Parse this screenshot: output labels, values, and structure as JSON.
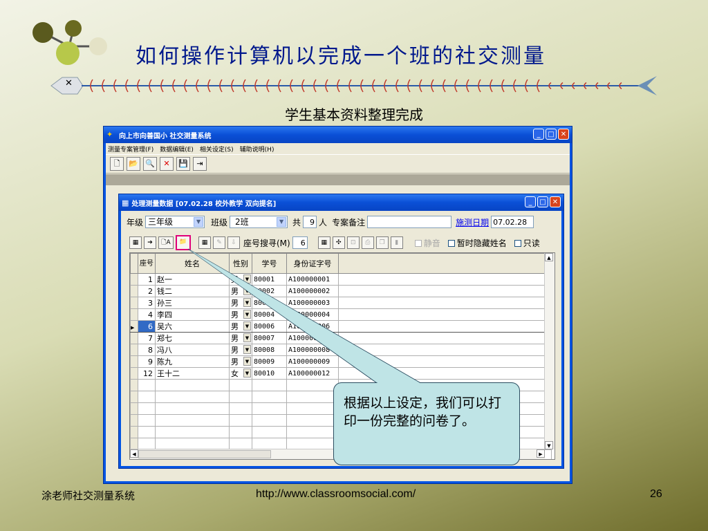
{
  "slide": {
    "title": "如何操作计算机以完成一个班的社交测量",
    "subtitle": "学生基本资料整理完成",
    "footer_left": "涂老师社交测量系统",
    "footer_url": "http://www.classroomsocial.com/",
    "page_number": "26",
    "fishbone_x": "✕"
  },
  "app": {
    "title": "向上市向善国小 社交测量系统",
    "menus": [
      "测量专案管理(F)",
      "数据编辑(E)",
      "相关设定(S)",
      "辅助说明(H)"
    ],
    "toolbar_icons": [
      "new-icon",
      "open-icon",
      "search-icon",
      "close-icon",
      "save-icon",
      "exit-icon"
    ],
    "toolbar_glyphs": [
      "🗋",
      "📂",
      "🔍",
      "✕",
      "💾",
      "⇥"
    ],
    "win_min": "_",
    "win_max": "□",
    "win_close": "✕"
  },
  "child": {
    "title": "处理测量数据 [07.02.28 校外教学 双向提名]",
    "grade_label": "年级",
    "grade_value": "三年级",
    "class_label": "班级",
    "class_value": "2班",
    "total_label": "共",
    "total_value": "9",
    "total_unit": "人",
    "note_label": "专案备注",
    "note_value": "",
    "date_label": "施测日期",
    "date_value": "07.02.28",
    "seat_search_label": "座号搜寻(M)",
    "seat_search_value": "6",
    "btn_grid": "▦",
    "btn_arrow": "➔",
    "btn_doc": "🗋A",
    "btn_folder": "📁",
    "btn_table": "▦",
    "mute_label": "静音",
    "hide_name_label": "暂时隐藏姓名",
    "readonly_label": "只读"
  },
  "grid": {
    "headers": [
      "座号",
      "姓名",
      "性别",
      "学号",
      "身份证字号"
    ],
    "rows": [
      {
        "seat": "1",
        "name": "赵一",
        "sex": "男",
        "sid": "80001",
        "idno": "A100000001"
      },
      {
        "seat": "2",
        "name": "钱二",
        "sex": "男",
        "sid": "80002",
        "idno": "A100000002"
      },
      {
        "seat": "3",
        "name": "孙三",
        "sex": "男",
        "sid": "80003",
        "idno": "A100000003"
      },
      {
        "seat": "4",
        "name": "李四",
        "sex": "男",
        "sid": "80004",
        "idno": "A100000004"
      },
      {
        "seat": "6",
        "name": "吴六",
        "sex": "男",
        "sid": "80006",
        "idno": "A100000006"
      },
      {
        "seat": "7",
        "name": "郑七",
        "sex": "男",
        "sid": "80007",
        "idno": "A100000007"
      },
      {
        "seat": "8",
        "name": "冯八",
        "sex": "男",
        "sid": "80008",
        "idno": "A100000008"
      },
      {
        "seat": "9",
        "name": "陈九",
        "sex": "男",
        "sid": "80009",
        "idno": "A100000009"
      },
      {
        "seat": "12",
        "name": "王十二",
        "sex": "女",
        "sid": "80010",
        "idno": "A100000012"
      }
    ],
    "current_row_index": 4
  },
  "callout": {
    "text": "根据以上设定，我们可以打印一份完整的问卷了。"
  },
  "colors": {
    "title_blue": "#00188c",
    "xp_blue": "#0054e3",
    "highlight_pink": "#e0007a",
    "callout_fill": "#bfe4e6"
  }
}
